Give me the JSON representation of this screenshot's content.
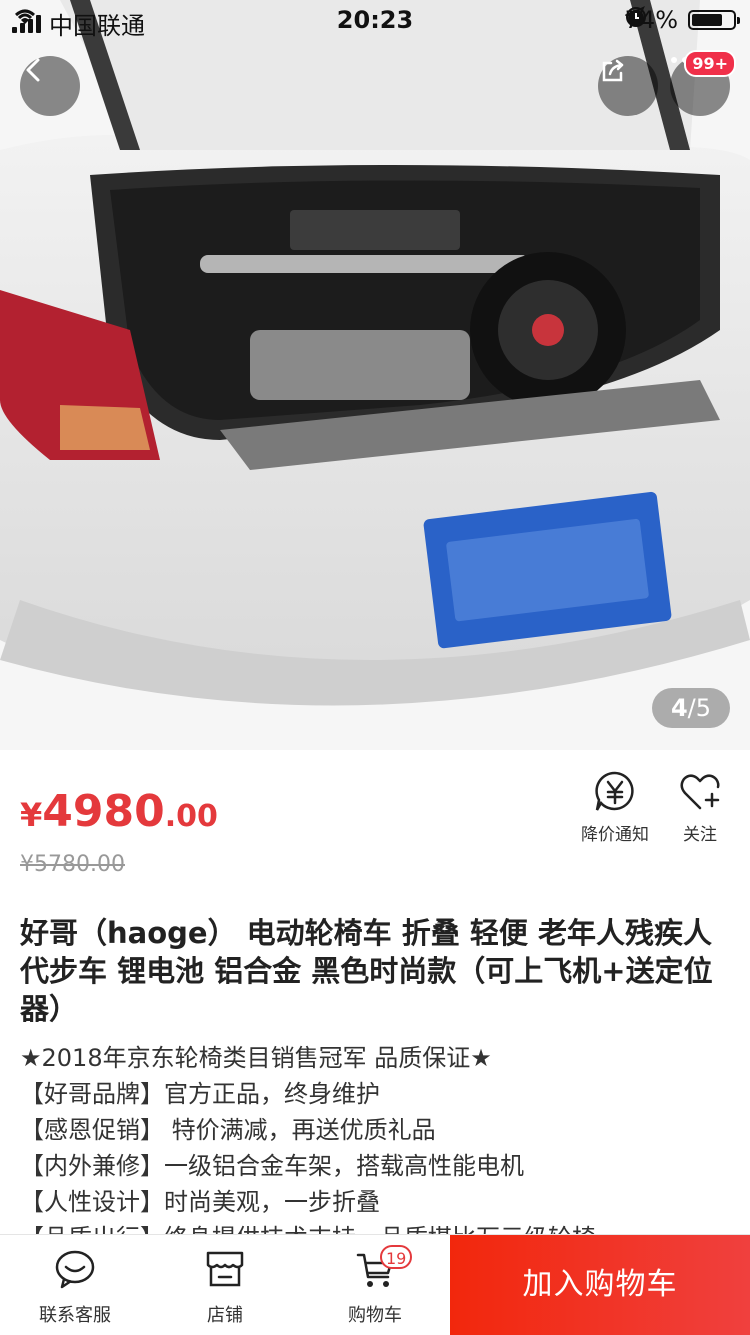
{
  "status_bar": {
    "carrier": "中国联通",
    "time": "20:23",
    "battery_text": "74%",
    "battery_level": 0.74
  },
  "gallery": {
    "current": "4",
    "separator": "/",
    "total": "5",
    "more_badge": "99+"
  },
  "price": {
    "currency": "¥",
    "integer": "4980",
    "decimal": ".00",
    "original": "¥5780.00",
    "accent": "#e4393c"
  },
  "actions": {
    "price_alert_label": "降价通知",
    "follow_label": "关注"
  },
  "product": {
    "title": "好哥（haoge）  电动轮椅车 折叠 轻便 老年人残疾人代步车 锂电池 铝合金 黑色时尚款（可上飞机+送定位器）",
    "desc_lines": [
      "★2018年京东轮椅类目销售冠军 品质保证★",
      "【好哥品牌】官方正品，终身维护",
      "【感恩促销】 特价满减，再送优质礼品",
      "【内外兼修】一级铝合金车架，搭载高性能电机",
      "【人性设计】时尚美观，一步折叠",
      "【品质出行】终身提供技术支持，品质堪比万元级轮椅"
    ]
  },
  "bottom_bar": {
    "service_label": "联系客服",
    "store_label": "店铺",
    "cart_label": "购物车",
    "cart_count": "19",
    "add_to_cart": "加入购物车"
  },
  "icons": {
    "back": "chevron-left-icon",
    "share": "share-icon",
    "more": "more-icon",
    "price_alert": "yen-bell-icon",
    "follow": "heart-plus-icon",
    "service": "chat-icon",
    "store": "store-icon",
    "cart": "cart-icon"
  }
}
